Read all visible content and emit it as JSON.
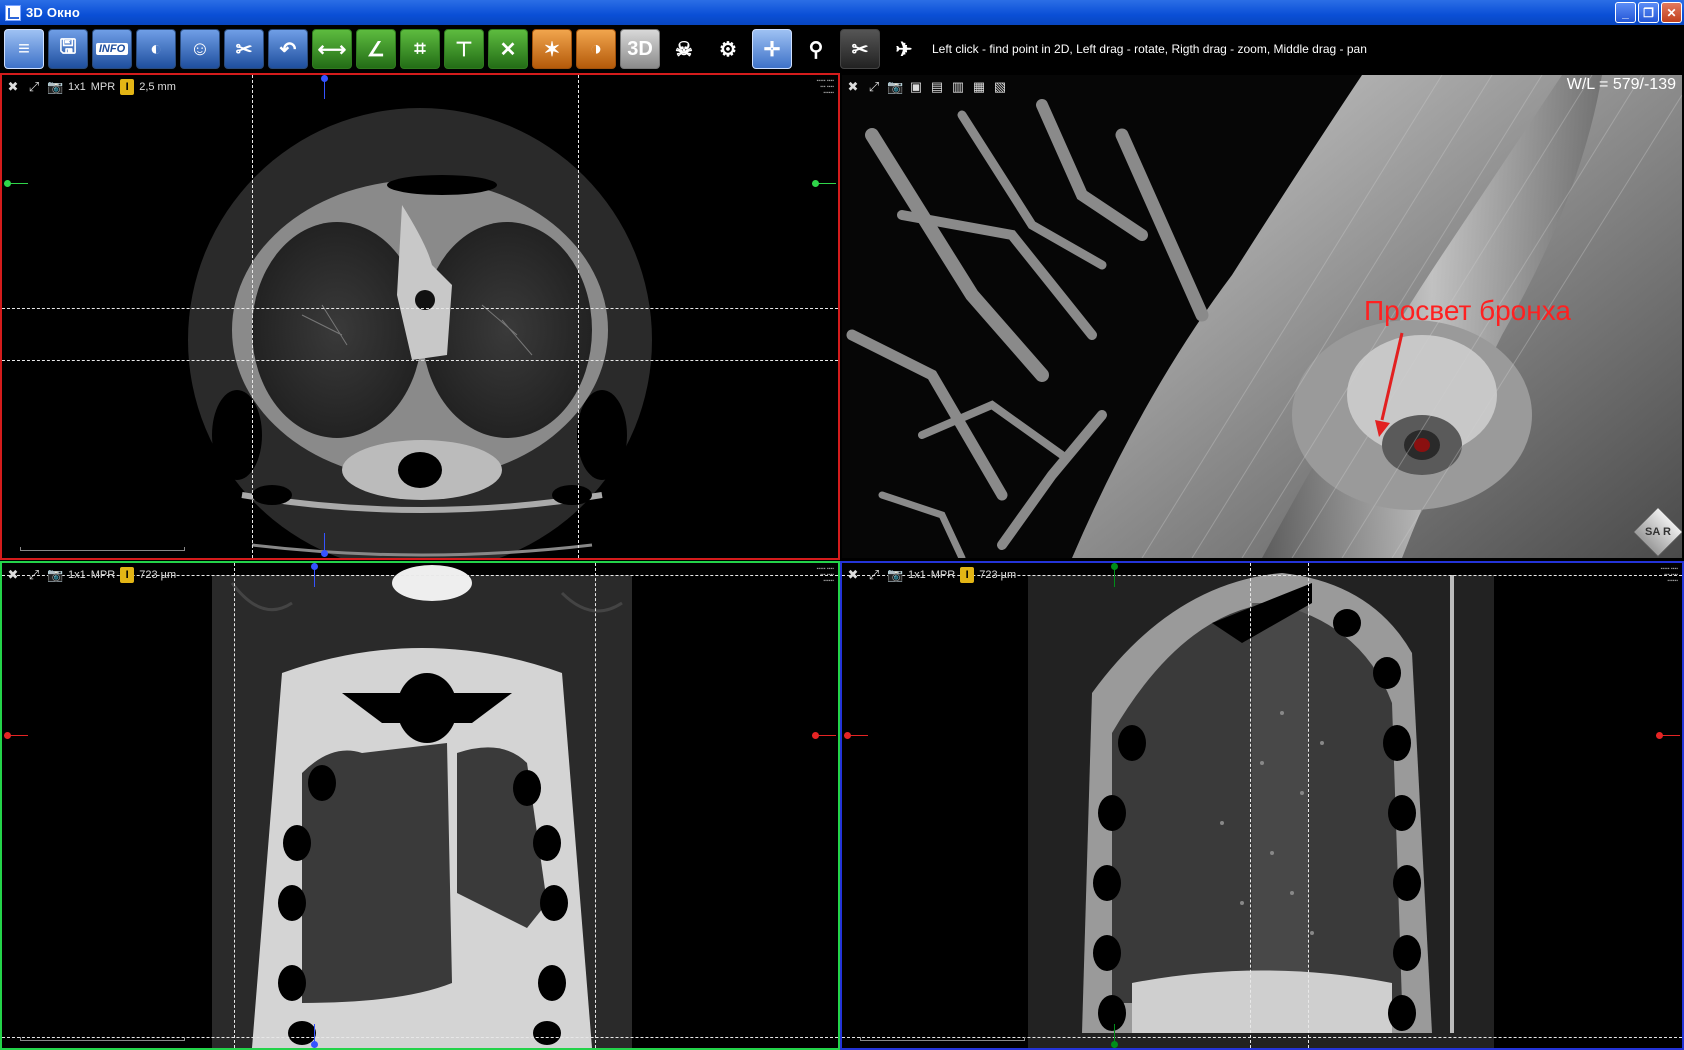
{
  "window": {
    "title": "3D Окно",
    "controls": {
      "minimize": "_",
      "maximize": "❐",
      "close": "✕"
    }
  },
  "toolbar": {
    "buttons": [
      {
        "name": "series-list-button",
        "icon": "series-icon",
        "glyph": "≡",
        "style": "sel"
      },
      {
        "name": "save-button",
        "icon": "floppy-icon",
        "glyph": "🖫",
        "style": "blue"
      },
      {
        "name": "info-button",
        "icon": "info-icon",
        "glyph": "INFO",
        "style": "blue"
      },
      {
        "name": "render-settings-button",
        "icon": "contrast-gear-icon",
        "glyph": "◐",
        "style": "blue"
      },
      {
        "name": "head-settings-button",
        "icon": "head-icon",
        "glyph": "☺",
        "style": "blue"
      },
      {
        "name": "tools-button",
        "icon": "tools-icon",
        "glyph": "✂",
        "style": "blue"
      },
      {
        "name": "undo-button",
        "icon": "undo-icon",
        "glyph": "↶",
        "style": "blue"
      },
      {
        "name": "ruler-button",
        "icon": "ruler-icon",
        "glyph": "⟷",
        "style": "green"
      },
      {
        "name": "angle-button",
        "icon": "angle-icon",
        "glyph": "∠",
        "style": "green"
      },
      {
        "name": "roi-button",
        "icon": "roi-icon",
        "glyph": "⌗",
        "style": "green"
      },
      {
        "name": "annotation-button",
        "icon": "annotation-icon",
        "glyph": "⊤",
        "style": "green"
      },
      {
        "name": "delete-button",
        "icon": "close-icon",
        "glyph": "✕",
        "style": "green"
      },
      {
        "name": "volume-render-button",
        "icon": "volume-icon",
        "glyph": "✶",
        "style": "orange"
      },
      {
        "name": "invert-button",
        "icon": "invert-icon",
        "glyph": "◑",
        "style": "orange"
      },
      {
        "name": "3d-button",
        "icon": "3d-icon",
        "glyph": "3D",
        "style": "gray"
      },
      {
        "name": "skull-button",
        "icon": "skull-icon",
        "glyph": "☠",
        "style": "plain"
      },
      {
        "name": "head-gear-button",
        "icon": "head-gear-icon",
        "glyph": "⚙",
        "style": "plain"
      },
      {
        "name": "crosshair-button",
        "icon": "crosshair-icon",
        "glyph": "✛",
        "style": "sel"
      },
      {
        "name": "magnifier-button",
        "icon": "magnifier-icon",
        "glyph": "⚲",
        "style": "plain"
      },
      {
        "name": "scissors-button",
        "icon": "scissors-icon",
        "glyph": "✂",
        "style": "dark"
      },
      {
        "name": "fly-through-button",
        "icon": "airplane-icon",
        "glyph": "✈",
        "style": "plain"
      }
    ],
    "hint": "Left click - find point in 2D, Left drag - rotate, Rigth drag - zoom, Middle drag - pan"
  },
  "viewports": {
    "axial": {
      "layout": "1x1",
      "mode": "MPR",
      "thickness": "2,5 mm"
    },
    "volume": {
      "wl": "W/L = 579/-139",
      "annotation": "Просвет бронха",
      "cube_letters": "SA R"
    },
    "coronal": {
      "layout": "1x1",
      "mode": "MPR",
      "thickness": "723 µm"
    },
    "sagittal": {
      "layout": "1x1",
      "mode": "MPR",
      "thickness": "723 µm"
    }
  },
  "colors": {
    "axial_border": "#d41c1c",
    "coronal_border": "#24d34a",
    "sagittal_border": "#2434d8",
    "annotation": "#ff2020"
  }
}
